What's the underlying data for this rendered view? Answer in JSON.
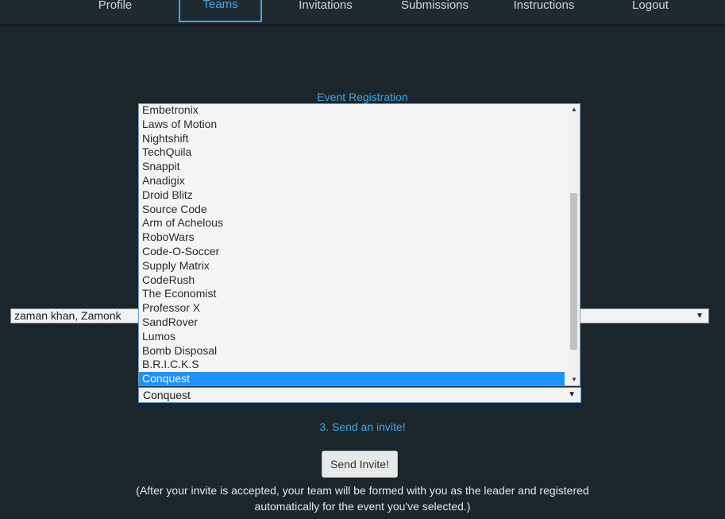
{
  "nav": {
    "items": [
      {
        "label": "Profile"
      },
      {
        "label": "Teams"
      },
      {
        "label": "Invitations"
      },
      {
        "label": "Submissions"
      },
      {
        "label": "Instructions"
      },
      {
        "label": "Logout"
      }
    ],
    "active": "Teams"
  },
  "heading": "Event Registration",
  "member_select": {
    "value": "zaman khan, Zamonk"
  },
  "event_list": {
    "options": [
      "Embetronix",
      "Laws of Motion",
      "Nightshift",
      "TechQuila",
      "Snappit",
      "Anadigix",
      "Droid Blitz",
      "Source Code",
      "Arm of Achelous",
      "RoboWars",
      "Code-O-Soccer",
      "Supply Matrix",
      "CodeRush",
      "The Economist",
      "Professor X",
      "SandRover",
      "Lumos",
      "Bomb Disposal",
      "B.R.I.C.K.S",
      "Conquest"
    ],
    "selected": "Conquest"
  },
  "event_select": {
    "value": "Conquest"
  },
  "step3": "3. Send an invite!",
  "send_button": "Send Invite!",
  "note_line1": "(After your invite is accepted, your team will be formed with you as the leader and registered",
  "note_line2": "automatically for the event you've selected.)",
  "colors": {
    "accent": "#3ea8e6",
    "background": "#1b262c",
    "selection": "#1e90ff"
  }
}
